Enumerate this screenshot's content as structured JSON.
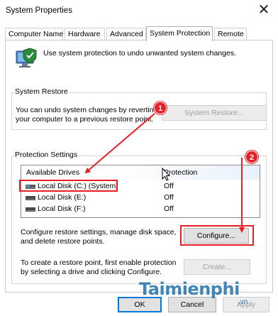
{
  "window": {
    "title": "System Properties",
    "close_symbol": "✕"
  },
  "tabs": [
    {
      "label": "Computer Name"
    },
    {
      "label": "Hardware"
    },
    {
      "label": "Advanced"
    },
    {
      "label": "System Protection"
    },
    {
      "label": "Remote"
    }
  ],
  "intro": {
    "text": "Use system protection to undo unwanted system changes."
  },
  "restore": {
    "group_label": "System Restore",
    "desc_line1": "You can undo system changes by revertin",
    "desc_line2": "your computer to a previous restore point.",
    "button_label": "System Restore..."
  },
  "protection": {
    "group_label": "Protection Settings",
    "col_drives": "Available Drives",
    "col_protection": "Protection",
    "drives": [
      {
        "name": "Local Disk (C:) (System)",
        "status": "Off"
      },
      {
        "name": "Local Disk (E:)",
        "status": "Off"
      },
      {
        "name": "Local Disk (F:)",
        "status": "Off"
      }
    ],
    "configure_line1": "Configure restore settings, manage disk space,",
    "configure_line2": "and delete restore points.",
    "configure_button": "Configure...",
    "create_line1": "To create a restore point, first enable protection",
    "create_line2": "by selecting a drive and clicking Configure.",
    "create_button": "Create..."
  },
  "footer": {
    "ok_label": "OK",
    "cancel_label": "Cancel",
    "apply_label": "Apply"
  },
  "annotations": {
    "badge1": "1",
    "badge2": "2",
    "color": "#e81d25"
  },
  "watermark": {
    "text": "Taimienphi",
    "sub": ".vn"
  }
}
